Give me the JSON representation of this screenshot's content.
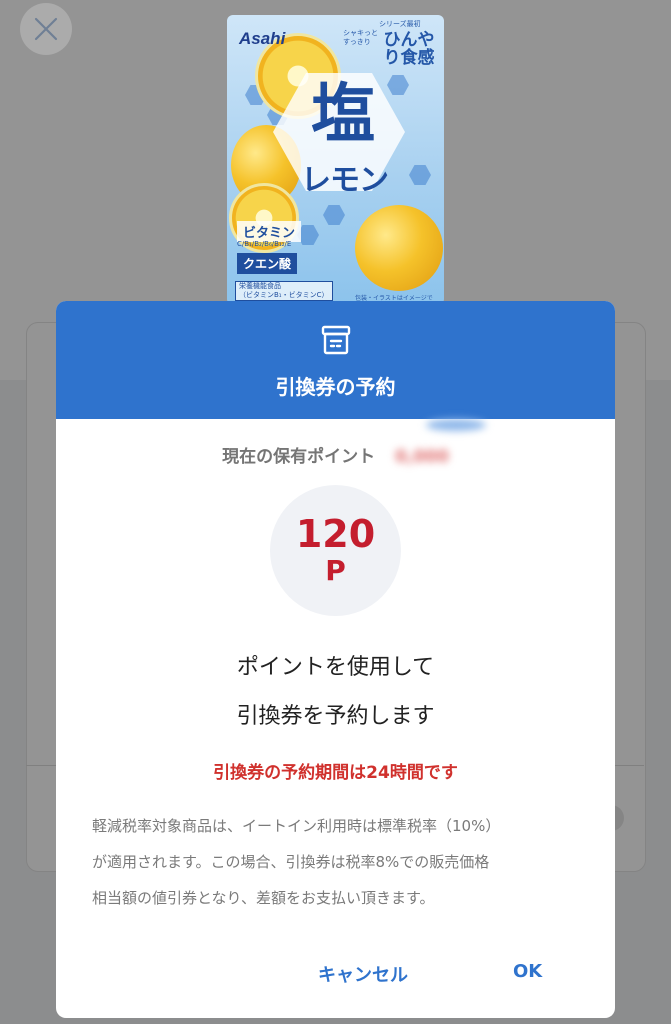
{
  "product": {
    "brand": "Asahi",
    "series_note": "シリーズ最初",
    "crisp_note": "シャキっとすっきり",
    "feature": "ひんやり食感",
    "name_main": "塩",
    "name_sub": "レモン",
    "vitamin": "ビタミン",
    "vitamin_sub": "C/B₁/B₂/B₆/B₁₂/E",
    "citric_acid": "クエン酸",
    "food_label": "栄養機能食品",
    "food_label_sub": "（ビタミンB₁・ビタミンC）",
    "image_note": "包装・イラストはイメージです。"
  },
  "modal": {
    "title": "引換券の予約",
    "points_label": "現在の保有ポイント",
    "points_value": "0,000",
    "cost_value": "120",
    "cost_unit": "P",
    "message_line1": "ポイントを使用して",
    "message_line2": "引換券を予約します",
    "notice": "引換券の予約期間は24時間です",
    "tax_note_lines": [
      "軽減税率対象商品は、イートイン利用時は標準税率（10%）",
      "が適用されます。この場合、引換券は税率8%での販売価格",
      "相当額の値引券となり、差額をお支払い頂きます。"
    ],
    "cancel_label": "キャンセル",
    "ok_label": "OK"
  },
  "icons": {
    "close": "close-icon",
    "ticket": "ticket-icon"
  },
  "colors": {
    "header_blue": "#2f73cd",
    "points_red": "#c41e2e",
    "notice_red": "#d0312d"
  }
}
